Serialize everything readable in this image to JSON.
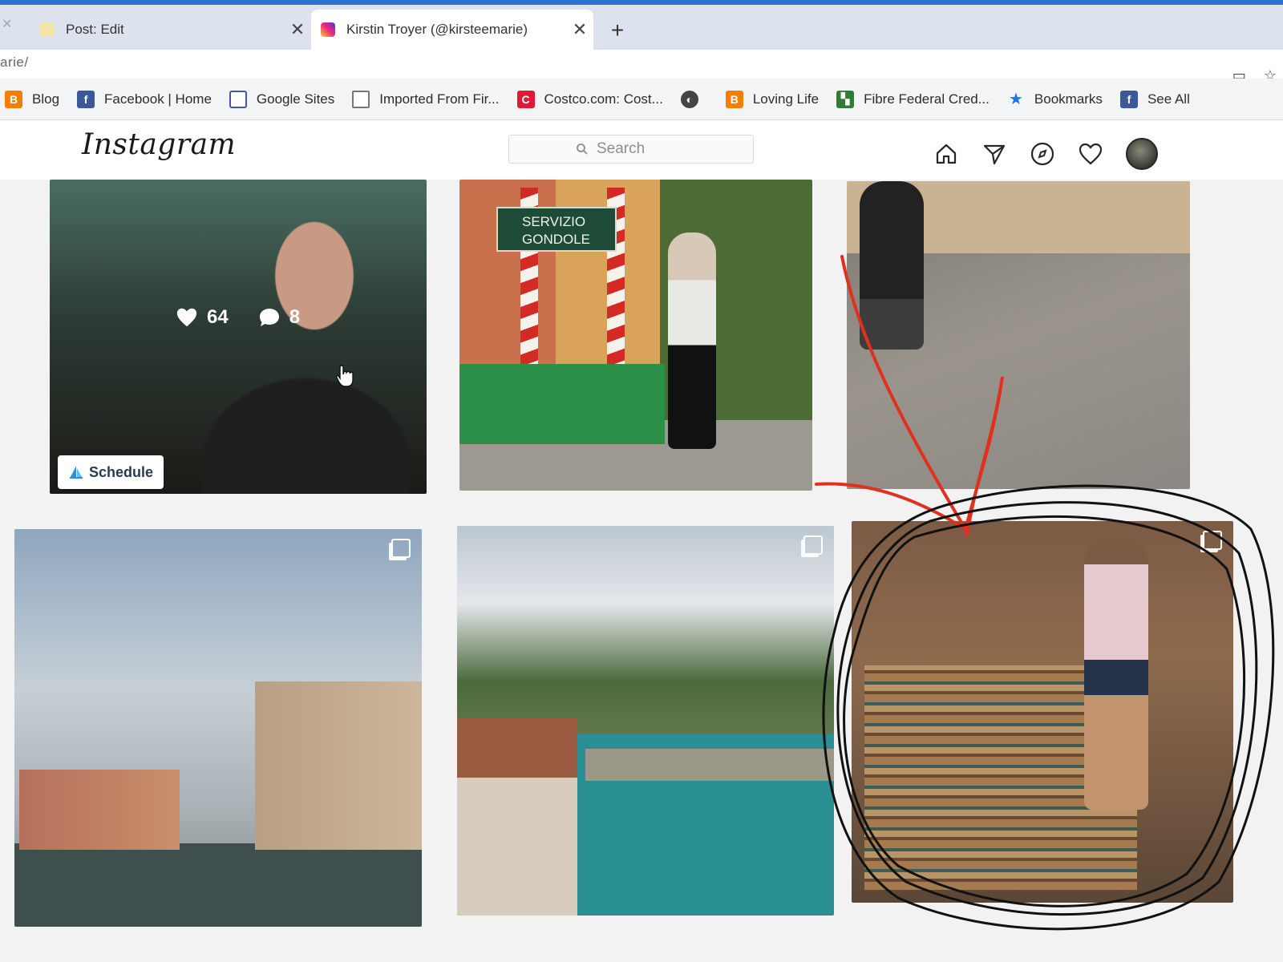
{
  "browser": {
    "tabs": [
      {
        "label": "Post: Edit",
        "active": false
      },
      {
        "label": "Kirstin Troyer (@kirsteemarie)",
        "active": true
      }
    ],
    "url_fragment": "arie/",
    "bookmarks": [
      {
        "label": "Blog",
        "icon": "blogger-icon",
        "color": "#f57d00"
      },
      {
        "label": "Facebook | Home",
        "icon": "facebook-icon",
        "color": "#3b5998"
      },
      {
        "label": "Google Sites",
        "icon": "google-sites-icon",
        "color": "#4a53a8"
      },
      {
        "label": "Imported From Fir...",
        "icon": "folder-icon",
        "color": "#777777"
      },
      {
        "label": "Costco.com: Cost...",
        "icon": "costco-icon",
        "color": "#e31837"
      },
      {
        "label": "",
        "icon": "globe-icon",
        "color": "#444444"
      },
      {
        "label": "Loving Life",
        "icon": "blogger-icon",
        "color": "#f57d00"
      },
      {
        "label": "Fibre Federal Cred...",
        "icon": "fibre-federal-icon",
        "color": "#2e7d32"
      },
      {
        "label": "Bookmarks",
        "icon": "star-icon",
        "color": "#1a73e8"
      },
      {
        "label": "See All",
        "icon": "facebook-icon",
        "color": "#3b5998"
      }
    ]
  },
  "instagram": {
    "logo": "Instagram",
    "search_placeholder": "Search"
  },
  "grid": {
    "hover_post": {
      "likes": "64",
      "comments": "8",
      "schedule_label": "Schedule"
    },
    "posts": [
      {
        "caption_text": ""
      },
      {
        "sign_text": "SERVIZIO GONDOLE"
      },
      {
        "caption_text": ""
      },
      {
        "caption_text": ""
      },
      {
        "caption_text": ""
      },
      {
        "caption_text": ""
      }
    ]
  },
  "colors": {
    "annotation_red": "#e0301e",
    "annotation_black": "#111111",
    "browser_accent": "#2f6fcf"
  }
}
